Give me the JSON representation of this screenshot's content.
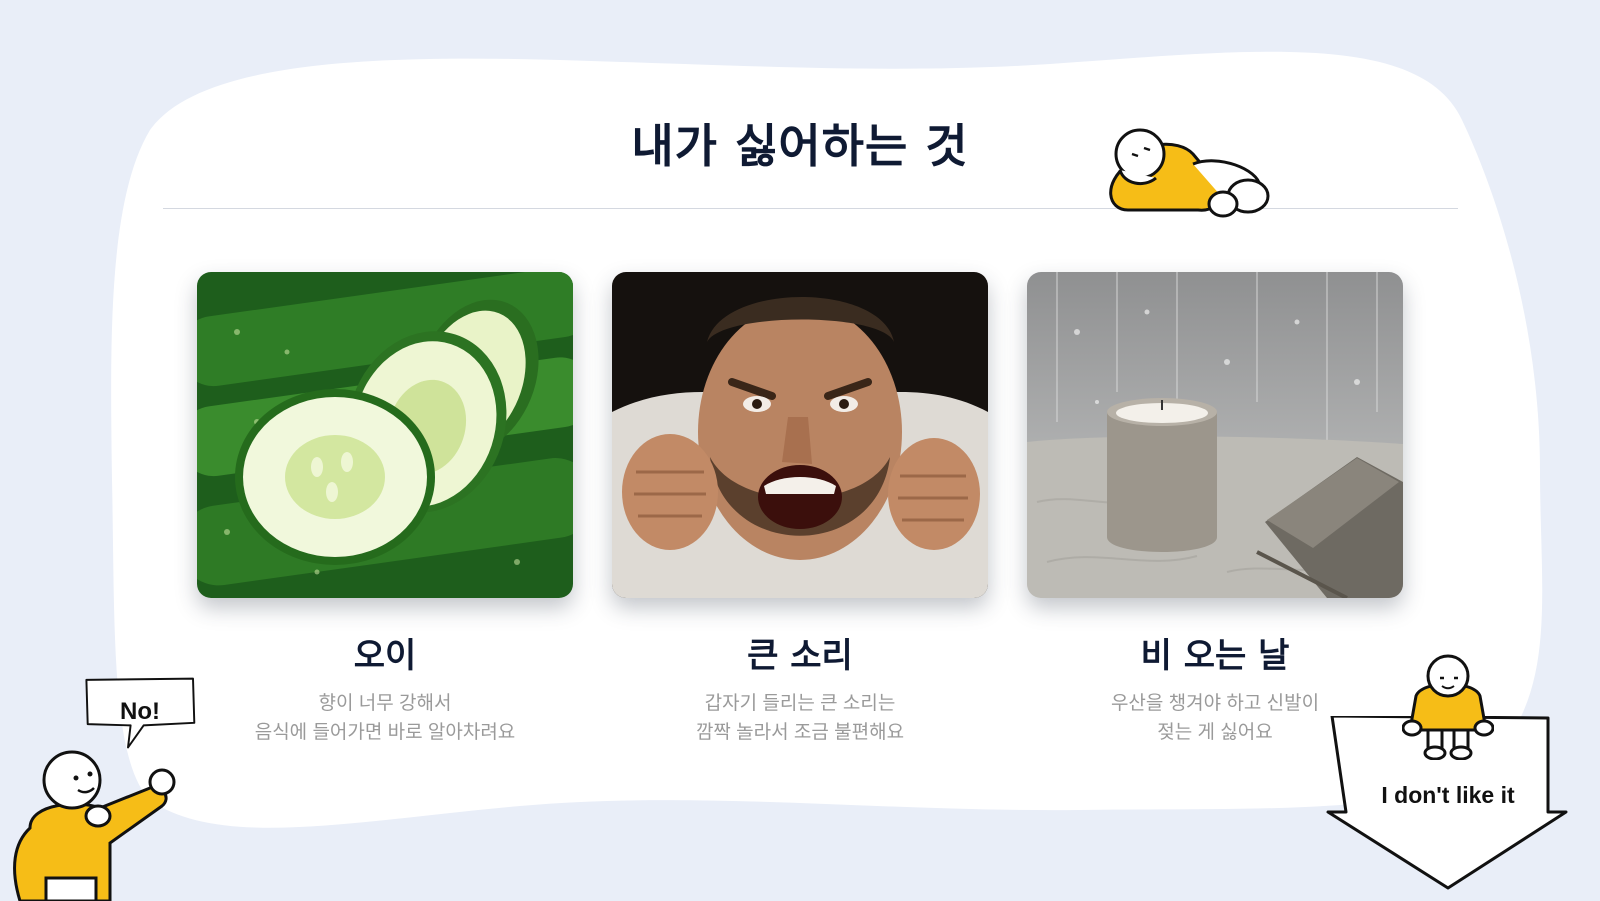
{
  "title": "내가 싫어하는 것",
  "cards": [
    {
      "title": "오이",
      "desc_line1": "향이 너무 강해서",
      "desc_line2": "음식에 들어가면 바로 알아차려요",
      "image": "cucumber-photo"
    },
    {
      "title": "큰 소리",
      "desc_line1": "갑자기 들리는 큰 소리는",
      "desc_line2": "깜짝 놀라서 조금 불편해요",
      "image": "shouting-man-photo"
    },
    {
      "title": "비 오는 날",
      "desc_line1": "우산을 챙겨야 하고 신발이",
      "desc_line2": "젖는 게 싫어요",
      "image": "rainy-window-candle-photo"
    }
  ],
  "speech_bubble": {
    "text": "No!"
  },
  "sign": {
    "text": "I don't like it"
  },
  "colors": {
    "background": "#e9eef8",
    "panel": "#ffffff",
    "accent_yellow": "#f6bd17",
    "title_text": "#0f1a33",
    "desc_text": "#9a9a9a"
  }
}
